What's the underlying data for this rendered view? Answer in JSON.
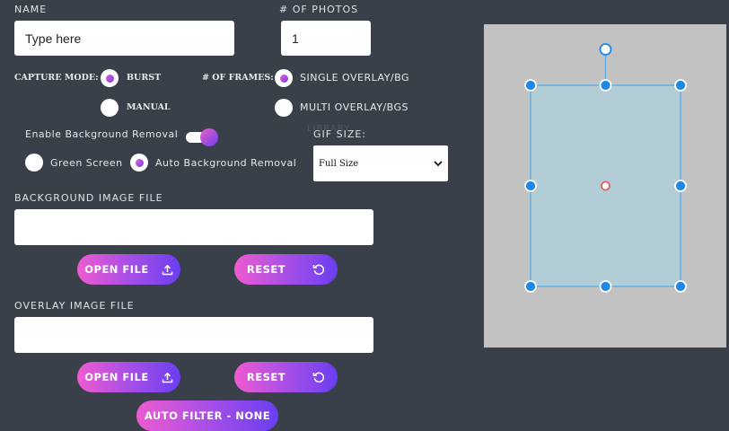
{
  "name": {
    "label": "NAME",
    "placeholder": "Type here",
    "value": "Type here"
  },
  "photos": {
    "label": "# OF PHOTOS",
    "value": "1"
  },
  "capture_mode": {
    "label": "CAPTURE MODE:",
    "options": [
      "BURST",
      "MANUAL"
    ],
    "selected": "BURST"
  },
  "frames": {
    "label": "# OF FRAMES:",
    "options": [
      "SINGLE OVERLAY/BG",
      "MULTI OVERLAY/BGS"
    ],
    "selected": "SINGLE OVERLAY/BG"
  },
  "bg_removal": {
    "label": "Enable Background Removal",
    "enabled": true,
    "options": [
      "Green Screen",
      "Auto Background Removal"
    ],
    "selected": "Auto Background Removal"
  },
  "gif_size": {
    "label": "GIF SIZE:",
    "value": "Full Size"
  },
  "background_file": {
    "label": "BACKGROUND IMAGE FILE",
    "value": "",
    "open_label": "OPEN FILE",
    "reset_label": "RESET"
  },
  "overlay_file": {
    "label": "OVERLAY IMAGE FILE",
    "value": "",
    "open_label": "OPEN FILE",
    "reset_label": "RESET"
  },
  "auto_filter": {
    "label": "AUTO FILTER - NONE"
  },
  "ghost_text": {
    "library": "LIBRARY"
  },
  "colors": {
    "background": "#3a4049",
    "accent_start": "#ee5bd0",
    "accent_end": "#6a3ef0",
    "canvas": "#c2c2c2",
    "selection": "#b2cdd6",
    "handle": "#1e88e5"
  }
}
